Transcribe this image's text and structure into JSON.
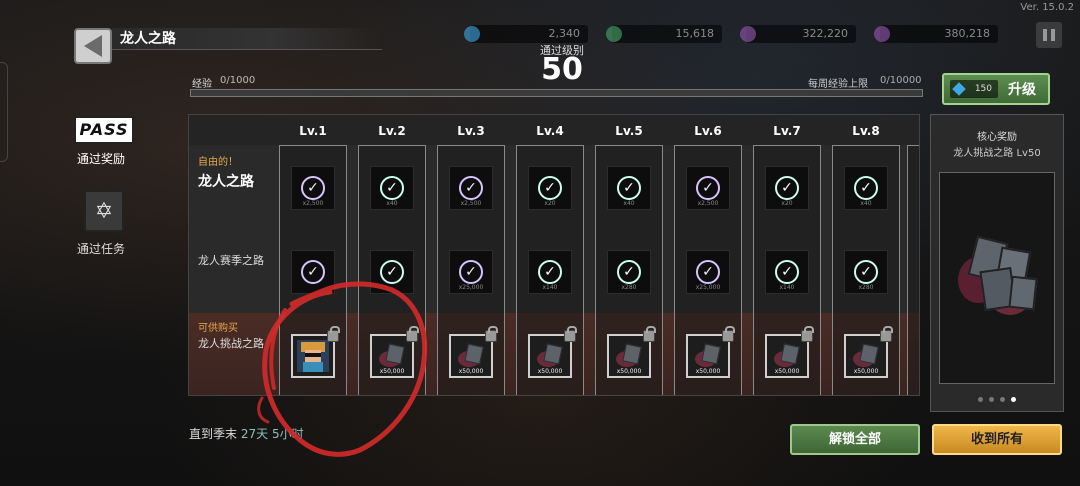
{
  "version": "Ver. 15.0.2",
  "header": {
    "title": "龙人之路",
    "currencies": [
      {
        "icon": "gem-icon",
        "value": "2,340",
        "color": "#3fa8e8"
      },
      {
        "icon": "coin-icon",
        "value": "15,618",
        "color": "#4aa86a"
      },
      {
        "icon": "star-icon",
        "value": "322,220",
        "color": "#9a5ab8"
      },
      {
        "icon": "star-icon",
        "value": "380,218",
        "color": "#9a5ab8"
      }
    ]
  },
  "pass": {
    "level_label": "通过级别",
    "level": "50",
    "exp_label": "经验",
    "exp_value": "0/1000",
    "exp_progress": 0,
    "weekly_label": "每周经验上限",
    "weekly_value": "0/10000",
    "upgrade": {
      "cost": "150",
      "label": "升级"
    }
  },
  "sidebar": {
    "items": [
      {
        "icon_text": "PASS",
        "label": "通过奖励"
      },
      {
        "icon_text": "✡",
        "label": "通过任务"
      }
    ]
  },
  "tracks": {
    "free": {
      "tag": "自由的！",
      "name": "龙人之路"
    },
    "season": {
      "name": "龙人赛季之路"
    },
    "premium": {
      "tag": "可供购买",
      "name": "龙人挑战之路"
    }
  },
  "levels": [
    {
      "label": "Lv.1",
      "free_qty": "x2,500",
      "season_qty": "",
      "buy_qty": "",
      "free_style": "purple",
      "season_style": "purple"
    },
    {
      "label": "Lv.2",
      "free_qty": "x40",
      "season_qty": "",
      "buy_qty": "x50,000",
      "free_style": "teal",
      "season_style": "teal"
    },
    {
      "label": "Lv.3",
      "free_qty": "x2,500",
      "season_qty": "x25,000",
      "buy_qty": "x50,000",
      "free_style": "purple",
      "season_style": "purple"
    },
    {
      "label": "Lv.4",
      "free_qty": "x20",
      "season_qty": "x140",
      "buy_qty": "x50,000",
      "free_style": "teal",
      "season_style": "teal"
    },
    {
      "label": "Lv.5",
      "free_qty": "x40",
      "season_qty": "x280",
      "buy_qty": "x50,000",
      "free_style": "teal",
      "season_style": "teal"
    },
    {
      "label": "Lv.6",
      "free_qty": "x2,500",
      "season_qty": "x25,000",
      "buy_qty": "x50,000",
      "free_style": "purple",
      "season_style": "purple"
    },
    {
      "label": "Lv.7",
      "free_qty": "x20",
      "season_qty": "x140",
      "buy_qty": "x50,000",
      "free_style": "teal",
      "season_style": "teal"
    },
    {
      "label": "Lv.8",
      "free_qty": "x40",
      "season_qty": "x280",
      "buy_qty": "x50,000",
      "free_style": "teal",
      "season_style": "teal"
    }
  ],
  "core_reward": {
    "title": "核心奖励",
    "subtitle": "龙人挑战之路 Lv50",
    "page_count": 4,
    "active_page": 4
  },
  "footer": {
    "countdown_label": "直到季末",
    "countdown_days": "27天",
    "countdown_hours": "5小时",
    "unlock_all": "解锁全部",
    "collect_all": "收到所有"
  },
  "colors": {
    "accent_green": "#5b8a4f",
    "accent_gold": "#f0b64a",
    "annotation_red": "#d42a2a"
  }
}
